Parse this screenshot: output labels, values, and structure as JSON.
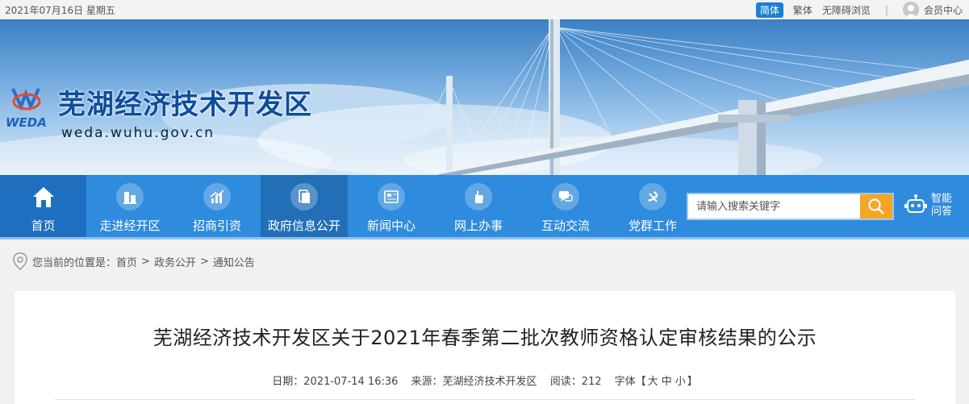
{
  "topbar": {
    "date": "2021年07月16日 星期五",
    "lang_simplified": "简体",
    "lang_traditional": "繁体",
    "accessibility": "无障碍浏览",
    "member_center": "会员中心"
  },
  "banner": {
    "site_name": "芜湖经济技术开发区",
    "site_url": "weda.wuhu.gov.cn",
    "logo_text": "WEDA"
  },
  "nav": {
    "items": [
      {
        "label": "首页",
        "icon": "home-icon"
      },
      {
        "label": "走进经开区",
        "icon": "building-icon"
      },
      {
        "label": "招商引资",
        "icon": "chart-icon"
      },
      {
        "label": "政府信息公开",
        "icon": "document-icon"
      },
      {
        "label": "新闻中心",
        "icon": "news-icon"
      },
      {
        "label": "网上办事",
        "icon": "hand-icon"
      },
      {
        "label": "互动交流",
        "icon": "chat-icon"
      },
      {
        "label": "党群工作",
        "icon": "party-emblem-icon"
      }
    ],
    "search_placeholder": "请输入搜索关键字",
    "assistant_label": "智能问答"
  },
  "breadcrumb": {
    "prefix": "您当前的位置是：",
    "items": [
      "首页",
      "政务公开",
      "通知公告"
    ]
  },
  "article": {
    "title": "芜湖经济技术开发区关于2021年春季第二批次教师资格认定审核结果的公示",
    "date": "日期：2021-07-14 16:36",
    "source": "来源：芜湖经济技术开发区",
    "views": "阅读：212",
    "font_label": "字体【",
    "font_large": "大",
    "font_medium": "中",
    "font_small": "小",
    "font_close": "】"
  },
  "colors": {
    "nav_bg": "#2f8bdd",
    "nav_active": "#226fb8",
    "search_button": "#f5a623",
    "brand_blue": "#0d4d9c"
  }
}
